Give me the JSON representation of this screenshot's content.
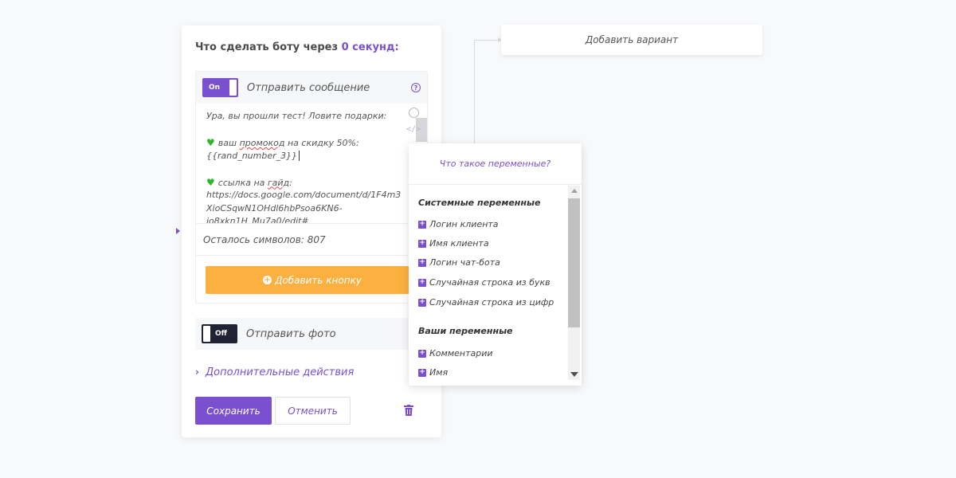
{
  "header": {
    "title_prefix": "Что сделать боту через",
    "title_delay": "0 секунд:"
  },
  "add_variant": {
    "label": "Добавить вариант"
  },
  "message_block": {
    "toggle_label": "On",
    "label": "Отправить сообщение",
    "help_icon": "?",
    "text_lines": {
      "l1": "Ура, вы прошли тест! Ловите подарки:",
      "l3_before": "ваш ",
      "l3_underlined": "промокод",
      "l3_after": " на скидку 50%:",
      "l4": "{{rand_number_3}}",
      "l6_before": "ссылка на ",
      "l6_underlined": "гайд",
      "l6_after": ":",
      "l7": "https://docs.google.com/document/d/1F4m3",
      "l8": "XioCSqwN1OHdl6hbPsoa6KN6-",
      "l9": "io8xkn1H_Mu7a0/edit#"
    },
    "code_icon": "</>",
    "counter": "Осталось символов: 807",
    "add_button_label": "Добавить кнопку"
  },
  "photo_block": {
    "toggle_label": "Off",
    "label": "Отправить фото"
  },
  "more_actions": {
    "label": "Дополнительные действия"
  },
  "actions": {
    "save": "Сохранить",
    "cancel": "Отменить"
  },
  "variables_popup": {
    "help_link": "Что такое переменные?",
    "system_title": "Системные переменные",
    "system_items": [
      "Логин клиента",
      "Имя клиента",
      "Логин чат-бота",
      "Случайная строка из букв",
      "Случайная строка из цифр"
    ],
    "user_title": "Ваши переменные",
    "user_items": [
      "Комментарии",
      "Имя"
    ]
  },
  "colors": {
    "accent": "#7a4fd0",
    "orange": "#fbb040",
    "dark_toggle": "#1f2333",
    "heart_green": "#2fb52f"
  }
}
